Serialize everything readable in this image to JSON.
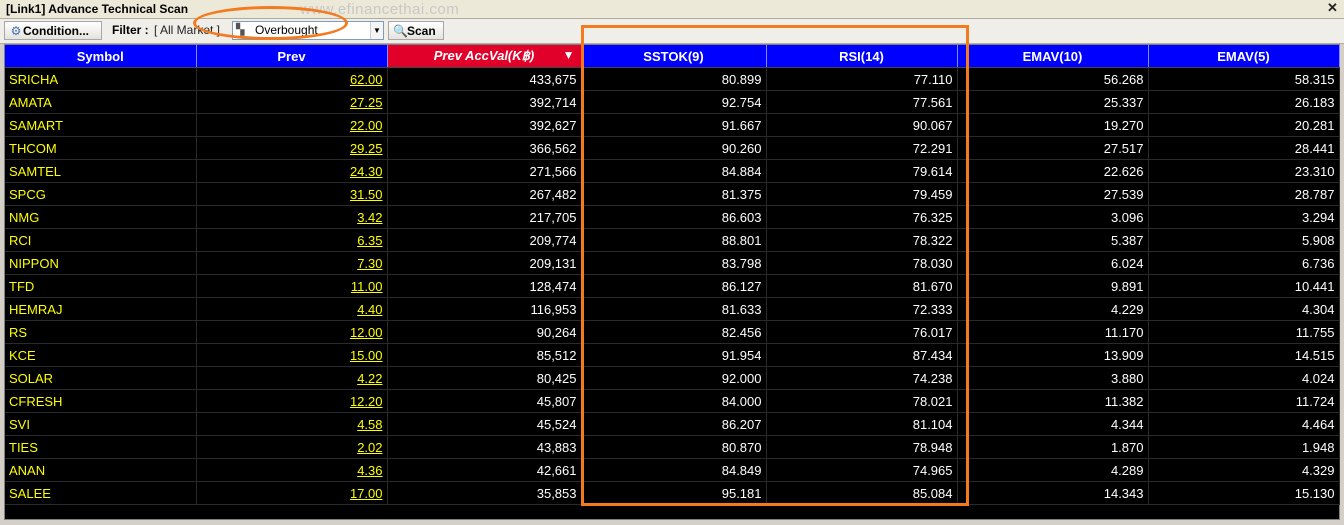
{
  "window": {
    "title": "[Link1] Advance Technical Scan",
    "watermark": "www.efinancethai.com"
  },
  "toolbar": {
    "condition_label": "Condition...",
    "filter_label": "Filter :",
    "filter_value": "[ All Market ]",
    "scan_select_value": "Overbought",
    "scan_label": "Scan"
  },
  "table": {
    "columns": [
      "Symbol",
      "Prev",
      "Prev AccVal(K฿)",
      "SSTOK(9)",
      "RSI(14)",
      "EMAV(10)",
      "EMAV(5)"
    ],
    "sorted_column": "Prev AccVal(K฿)",
    "sort_direction": "descending",
    "rows": [
      [
        "SRICHA",
        "62.00",
        "433,675",
        "80.899",
        "77.110",
        "56.268",
        "58.315"
      ],
      [
        "AMATA",
        "27.25",
        "392,714",
        "92.754",
        "77.561",
        "25.337",
        "26.183"
      ],
      [
        "SAMART",
        "22.00",
        "392,627",
        "91.667",
        "90.067",
        "19.270",
        "20.281"
      ],
      [
        "THCOM",
        "29.25",
        "366,562",
        "90.260",
        "72.291",
        "27.517",
        "28.441"
      ],
      [
        "SAMTEL",
        "24.30",
        "271,566",
        "84.884",
        "79.614",
        "22.626",
        "23.310"
      ],
      [
        "SPCG",
        "31.50",
        "267,482",
        "81.375",
        "79.459",
        "27.539",
        "28.787"
      ],
      [
        "NMG",
        "3.42",
        "217,705",
        "86.603",
        "76.325",
        "3.096",
        "3.294"
      ],
      [
        "RCI",
        "6.35",
        "209,774",
        "88.801",
        "78.322",
        "5.387",
        "5.908"
      ],
      [
        "NIPPON",
        "7.30",
        "209,131",
        "83.798",
        "78.030",
        "6.024",
        "6.736"
      ],
      [
        "TFD",
        "11.00",
        "128,474",
        "86.127",
        "81.670",
        "9.891",
        "10.441"
      ],
      [
        "HEMRAJ",
        "4.40",
        "116,953",
        "81.633",
        "72.333",
        "4.229",
        "4.304"
      ],
      [
        "RS",
        "12.00",
        "90,264",
        "82.456",
        "76.017",
        "11.170",
        "11.755"
      ],
      [
        "KCE",
        "15.00",
        "85,512",
        "91.954",
        "87.434",
        "13.909",
        "14.515"
      ],
      [
        "SOLAR",
        "4.22",
        "80,425",
        "92.000",
        "74.238",
        "3.880",
        "4.024"
      ],
      [
        "CFRESH",
        "12.20",
        "45,807",
        "84.000",
        "78.021",
        "11.382",
        "11.724"
      ],
      [
        "SVI",
        "4.58",
        "45,524",
        "86.207",
        "81.104",
        "4.344",
        "4.464"
      ],
      [
        "TIES",
        "2.02",
        "43,883",
        "80.870",
        "78.948",
        "1.870",
        "1.948"
      ],
      [
        "ANAN",
        "4.36",
        "42,661",
        "84.849",
        "74.965",
        "4.289",
        "4.329"
      ],
      [
        "SALEE",
        "17.00",
        "35,853",
        "95.181",
        "85.084",
        "14.343",
        "15.130"
      ]
    ]
  },
  "icons": {
    "condition": "condition-icon",
    "scan_type": "scan-type-icon",
    "dropdown": "chevron-down-icon",
    "scan": "search-icon",
    "close": "close-icon",
    "sort": "sort-desc-icon"
  },
  "colors": {
    "header_bg": "#0000ff",
    "sorted_header_bg": "#e0002a",
    "grid_bg": "#000000",
    "symbol_text": "#ffff00",
    "value_text": "#ffffff",
    "highlight": "#f47a20"
  }
}
